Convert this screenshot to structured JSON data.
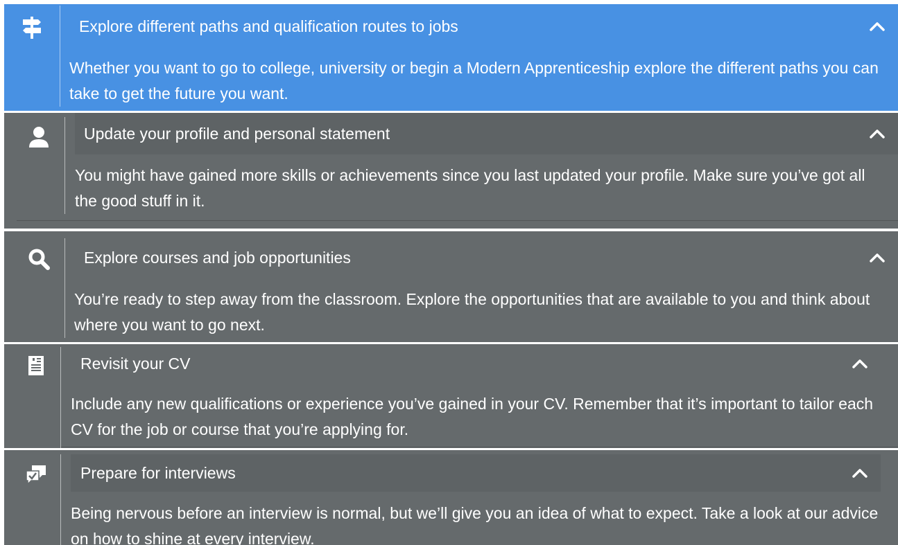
{
  "colors": {
    "active_panel": "#4891e3",
    "panel": "#656a6c",
    "header_bar": "#5e6365",
    "text": "#ffffff"
  },
  "accordion": [
    {
      "icon": "signpost-icon",
      "title": "Explore different paths and qualification routes to jobs",
      "body": "Whether you want to go to college, university or begin a Modern Apprenticeship explore the different paths you can take to get the future you want."
    },
    {
      "icon": "user-icon",
      "title": "Update your profile and personal statement",
      "body": "You might have gained more skills or achievements since you last updated your profile. Make sure you’ve got all the good stuff in it."
    },
    {
      "icon": "search-icon",
      "title": "Explore courses and job opportunities",
      "body": "You’re ready to step away from the classroom. Explore the opportunities that are available to you and think about where you want to go next."
    },
    {
      "icon": "document-icon",
      "title": "Revisit your CV",
      "body": "Include any new qualifications or experience you’ve gained in your CV. Remember that it’s important to tailor each CV for the job or course that you’re applying for."
    },
    {
      "icon": "chat-check-icon",
      "title": "Prepare for interviews",
      "body": "Being nervous before an interview is normal, but we’ll give you an idea of what to expect. Take a look at our advice on how to shine at every interview."
    }
  ]
}
